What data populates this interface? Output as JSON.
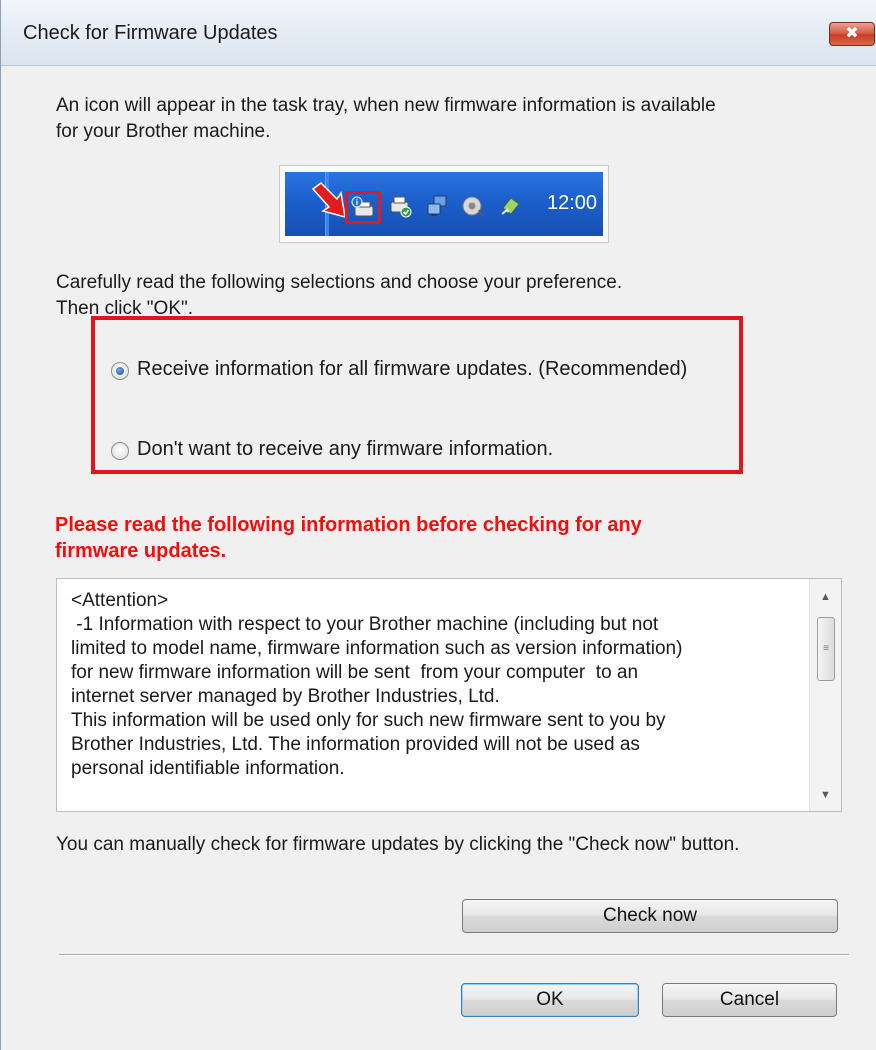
{
  "window": {
    "title": "Check for Firmware Updates",
    "close_label": "✖"
  },
  "intro": {
    "line1": "An icon will appear in the task tray, when new firmware information is available",
    "line2": "for your Brother machine."
  },
  "tray": {
    "clock": "12:00",
    "icons": [
      "firmware-notice-icon",
      "printer-status-icon",
      "network-icon",
      "speaker-icon",
      "safely-remove-icon"
    ],
    "highlight_color": "#e21b1b"
  },
  "instructions": {
    "line1": "Carefully read the following selections and choose your preference.",
    "line2": "Then click \"OK\"."
  },
  "options": {
    "receive_all": {
      "label": "Receive information for all firmware updates. (Recommended)",
      "selected": true
    },
    "none": {
      "label": "Don't want to receive any firmware information.",
      "selected": false
    }
  },
  "warning": {
    "line1": "Please read the following information before checking for any",
    "line2": "firmware updates.",
    "color": "#f30d0d"
  },
  "attention": {
    "text": "<Attention>\n -1 Information with respect to your Brother machine (including but not\nlimited to model name, firmware information such as version information)\nfor new firmware information will be sent  from your computer  to an\ninternet server managed by Brother Industries, Ltd.\nThis information will be used only for such new firmware sent to you by\nBrother Industries, Ltd. The information provided will not be used as\npersonal identifiable information."
  },
  "manual_check": {
    "text": "You can manually check for firmware updates by clicking the \"Check now\" button."
  },
  "buttons": {
    "check_now": "Check now",
    "ok": "OK",
    "cancel": "Cancel"
  }
}
